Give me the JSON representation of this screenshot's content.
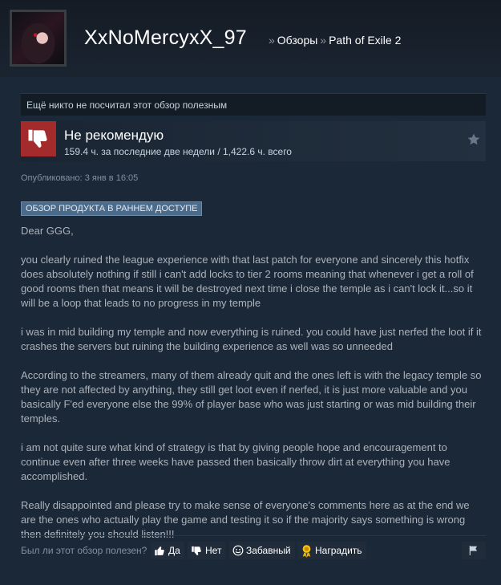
{
  "header": {
    "persona_name": "XxNoMercyxX_97",
    "breadcrumb_sep": "»",
    "breadcrumbs": [
      "Обзоры",
      "Path of Exile 2"
    ]
  },
  "helpful_status": "Ещё никто не посчитал этот обзор полезным",
  "verdict": {
    "title": "Не рекомендую",
    "hours": "159.4 ч. за последние две недели / 1,422.6 ч. всего",
    "thumb_color": "#a42b2b"
  },
  "posted": "Опубликовано: 3 янв в 16:05",
  "early_access_badge": "ОБЗОР ПРОДУКТА В РАННЕМ ДОСТУПЕ",
  "review_paragraphs": [
    "Dear GGG,",
    "you clearly ruined the league experience with that last patch for everyone and sincerely this hotfix does absolutely nothing if still i can't add locks to tier 2 rooms meaning that whenever i get a roll of good rooms then that means it will be destroyed next time i close the temple as i can't lock it...so it will be a loop that leads to no progress in my temple",
    "i was in mid building my temple and now everything is ruined. you could have just nerfed the loot if it crashes the servers but ruining the building experience as well was so unneeded",
    "According to the streamers, many of them already quit and the ones left is with the legacy temple so they are not affected by anything, they still get loot even if nerfed, it is just more valuable and you basically F'ed everyone else the 99% of player base who was just starting or was mid building their temples.",
    "i am not quite sure what kind of strategy is that by giving people hope and encouragement to continue even after three weeks have passed then basically throw dirt at everything you have accomplished.",
    "Really disappointed and please try to make sense of everyone's comments here as at the end we are the ones who actually play the game and testing it so if the majority says something is wrong then definitely you should listen!!!"
  ],
  "controls": {
    "question": "Был ли этот обзор полезен?",
    "yes": "Да",
    "no": "Нет",
    "funny": "Забавный",
    "award": "Наградить"
  },
  "colors": {
    "background": "#1b2838",
    "text": "#acb2b8",
    "negative": "#a42b2b",
    "badge": "#4c6b8a"
  }
}
